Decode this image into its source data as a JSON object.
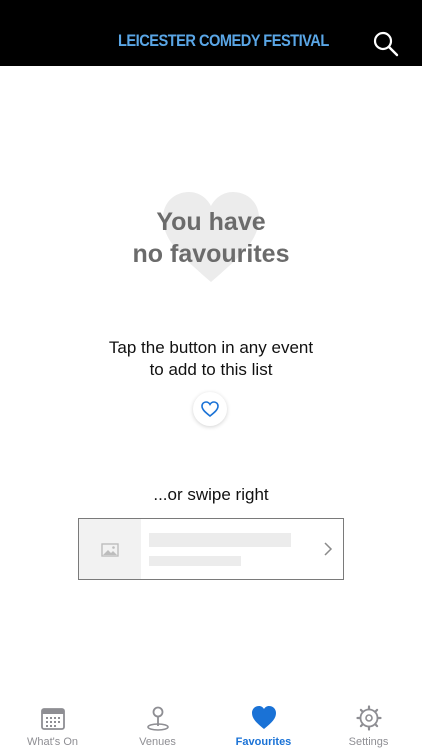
{
  "header": {
    "logo_text": "LEICESTER COMEDY FESTIVAL",
    "search_icon": "search-icon"
  },
  "empty_state": {
    "title_line1": "You have",
    "title_line2": "no favourites",
    "background_icon": "heart-icon"
  },
  "instructions": {
    "line1": "Tap the button in any event",
    "line2": "to add to this list",
    "button_icon": "heart-outline-icon"
  },
  "swipe_hint": {
    "text": "...or swipe right",
    "card_icons": [
      "image-icon",
      "chevron-right-icon"
    ]
  },
  "tabbar": {
    "tabs": [
      {
        "label": "What's On",
        "icon": "calendar-icon",
        "active": false
      },
      {
        "label": "Venues",
        "icon": "map-pin-icon",
        "active": false
      },
      {
        "label": "Favourites",
        "icon": "heart-icon",
        "active": true
      },
      {
        "label": "Settings",
        "icon": "gear-icon",
        "active": false
      }
    ]
  },
  "colors": {
    "header_bg": "#000000",
    "logo": "#5aa6e6",
    "accent": "#1a72d6",
    "inactive": "#8e8e93",
    "empty_title": "#6b6b6b"
  }
}
